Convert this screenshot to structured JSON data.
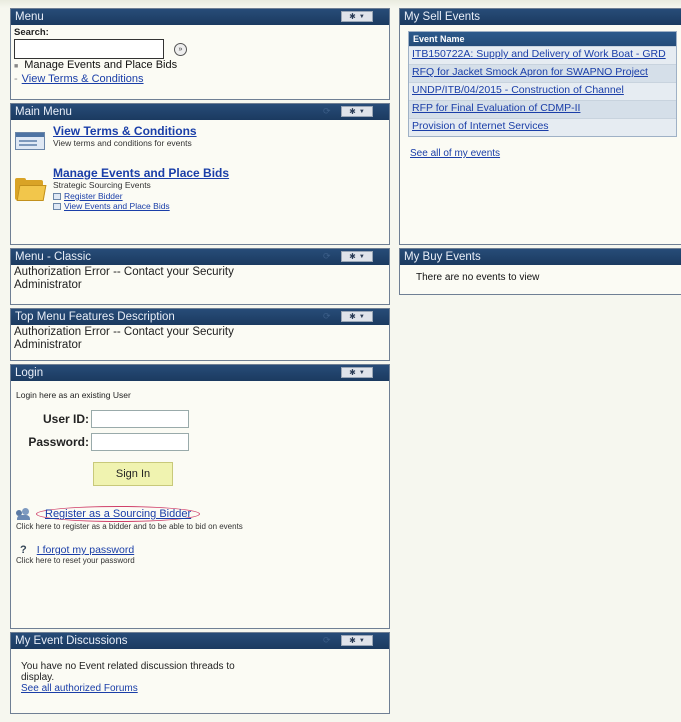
{
  "menu": {
    "title": "Menu",
    "search_label": "Search:",
    "search_value": "",
    "go_label": "»",
    "link1": "Manage Events and Place Bids",
    "link2": "View Terms & Conditions"
  },
  "main_menu": {
    "title": "Main Menu",
    "item1_title": "View Terms & Conditions",
    "item1_desc": "View terms and conditions for events",
    "item2_title": "Manage Events and Place Bids",
    "item2_desc": "Strategic Sourcing Events",
    "item2_sub1": "Register Bidder",
    "item2_sub2": "View Events and Place Bids"
  },
  "menu_classic": {
    "title": "Menu - Classic",
    "message": "Authorization Error -- Contact your Security Administrator"
  },
  "top_menu": {
    "title": "Top Menu Features Description",
    "message": "Authorization Error -- Contact your Security Administrator"
  },
  "login": {
    "title": "Login",
    "intro": "Login here as an existing User",
    "user_label": "User ID:",
    "password_label": "Password:",
    "user_value": "",
    "password_value": "",
    "signin": "Sign In",
    "register_link": "Register as a Sourcing Bidder",
    "register_note": "Click here to register as a bidder and to be able to bid on events",
    "forgot_link": "I forgot my password",
    "forgot_note": "Click here to reset your password"
  },
  "discussions": {
    "title": "My Event Discussions",
    "message": "You have no Event related discussion threads to display.",
    "link": "See all authorized Forums"
  },
  "sell_events": {
    "title": "My Sell Events",
    "column": "Event Name",
    "rows": [
      "ITB150722A: Supply and Delivery of Work Boat - GRD",
      "RFQ for Jacket Smock Apron for SWAPNO Project",
      "UNDP/ITB/04/2015 - Construction of Channel",
      "RFP for Final Evaluation of CDMP-II",
      "Provision of Internet Services"
    ],
    "see_all": "See all of my events"
  },
  "buy_events": {
    "title": "My Buy Events",
    "message": "There are no events to view"
  },
  "icons": {
    "control": "gear-icon",
    "dropdown": "chevron-down-icon",
    "help": "help-icon",
    "folder": "folder-icon",
    "terms": "document-icon",
    "users": "users-icon"
  },
  "colors": {
    "header_bg": "#1b3a60",
    "link": "#1a3ea8",
    "highlight_circle": "#d0406a",
    "signin_bg": "#f0f3b0"
  }
}
